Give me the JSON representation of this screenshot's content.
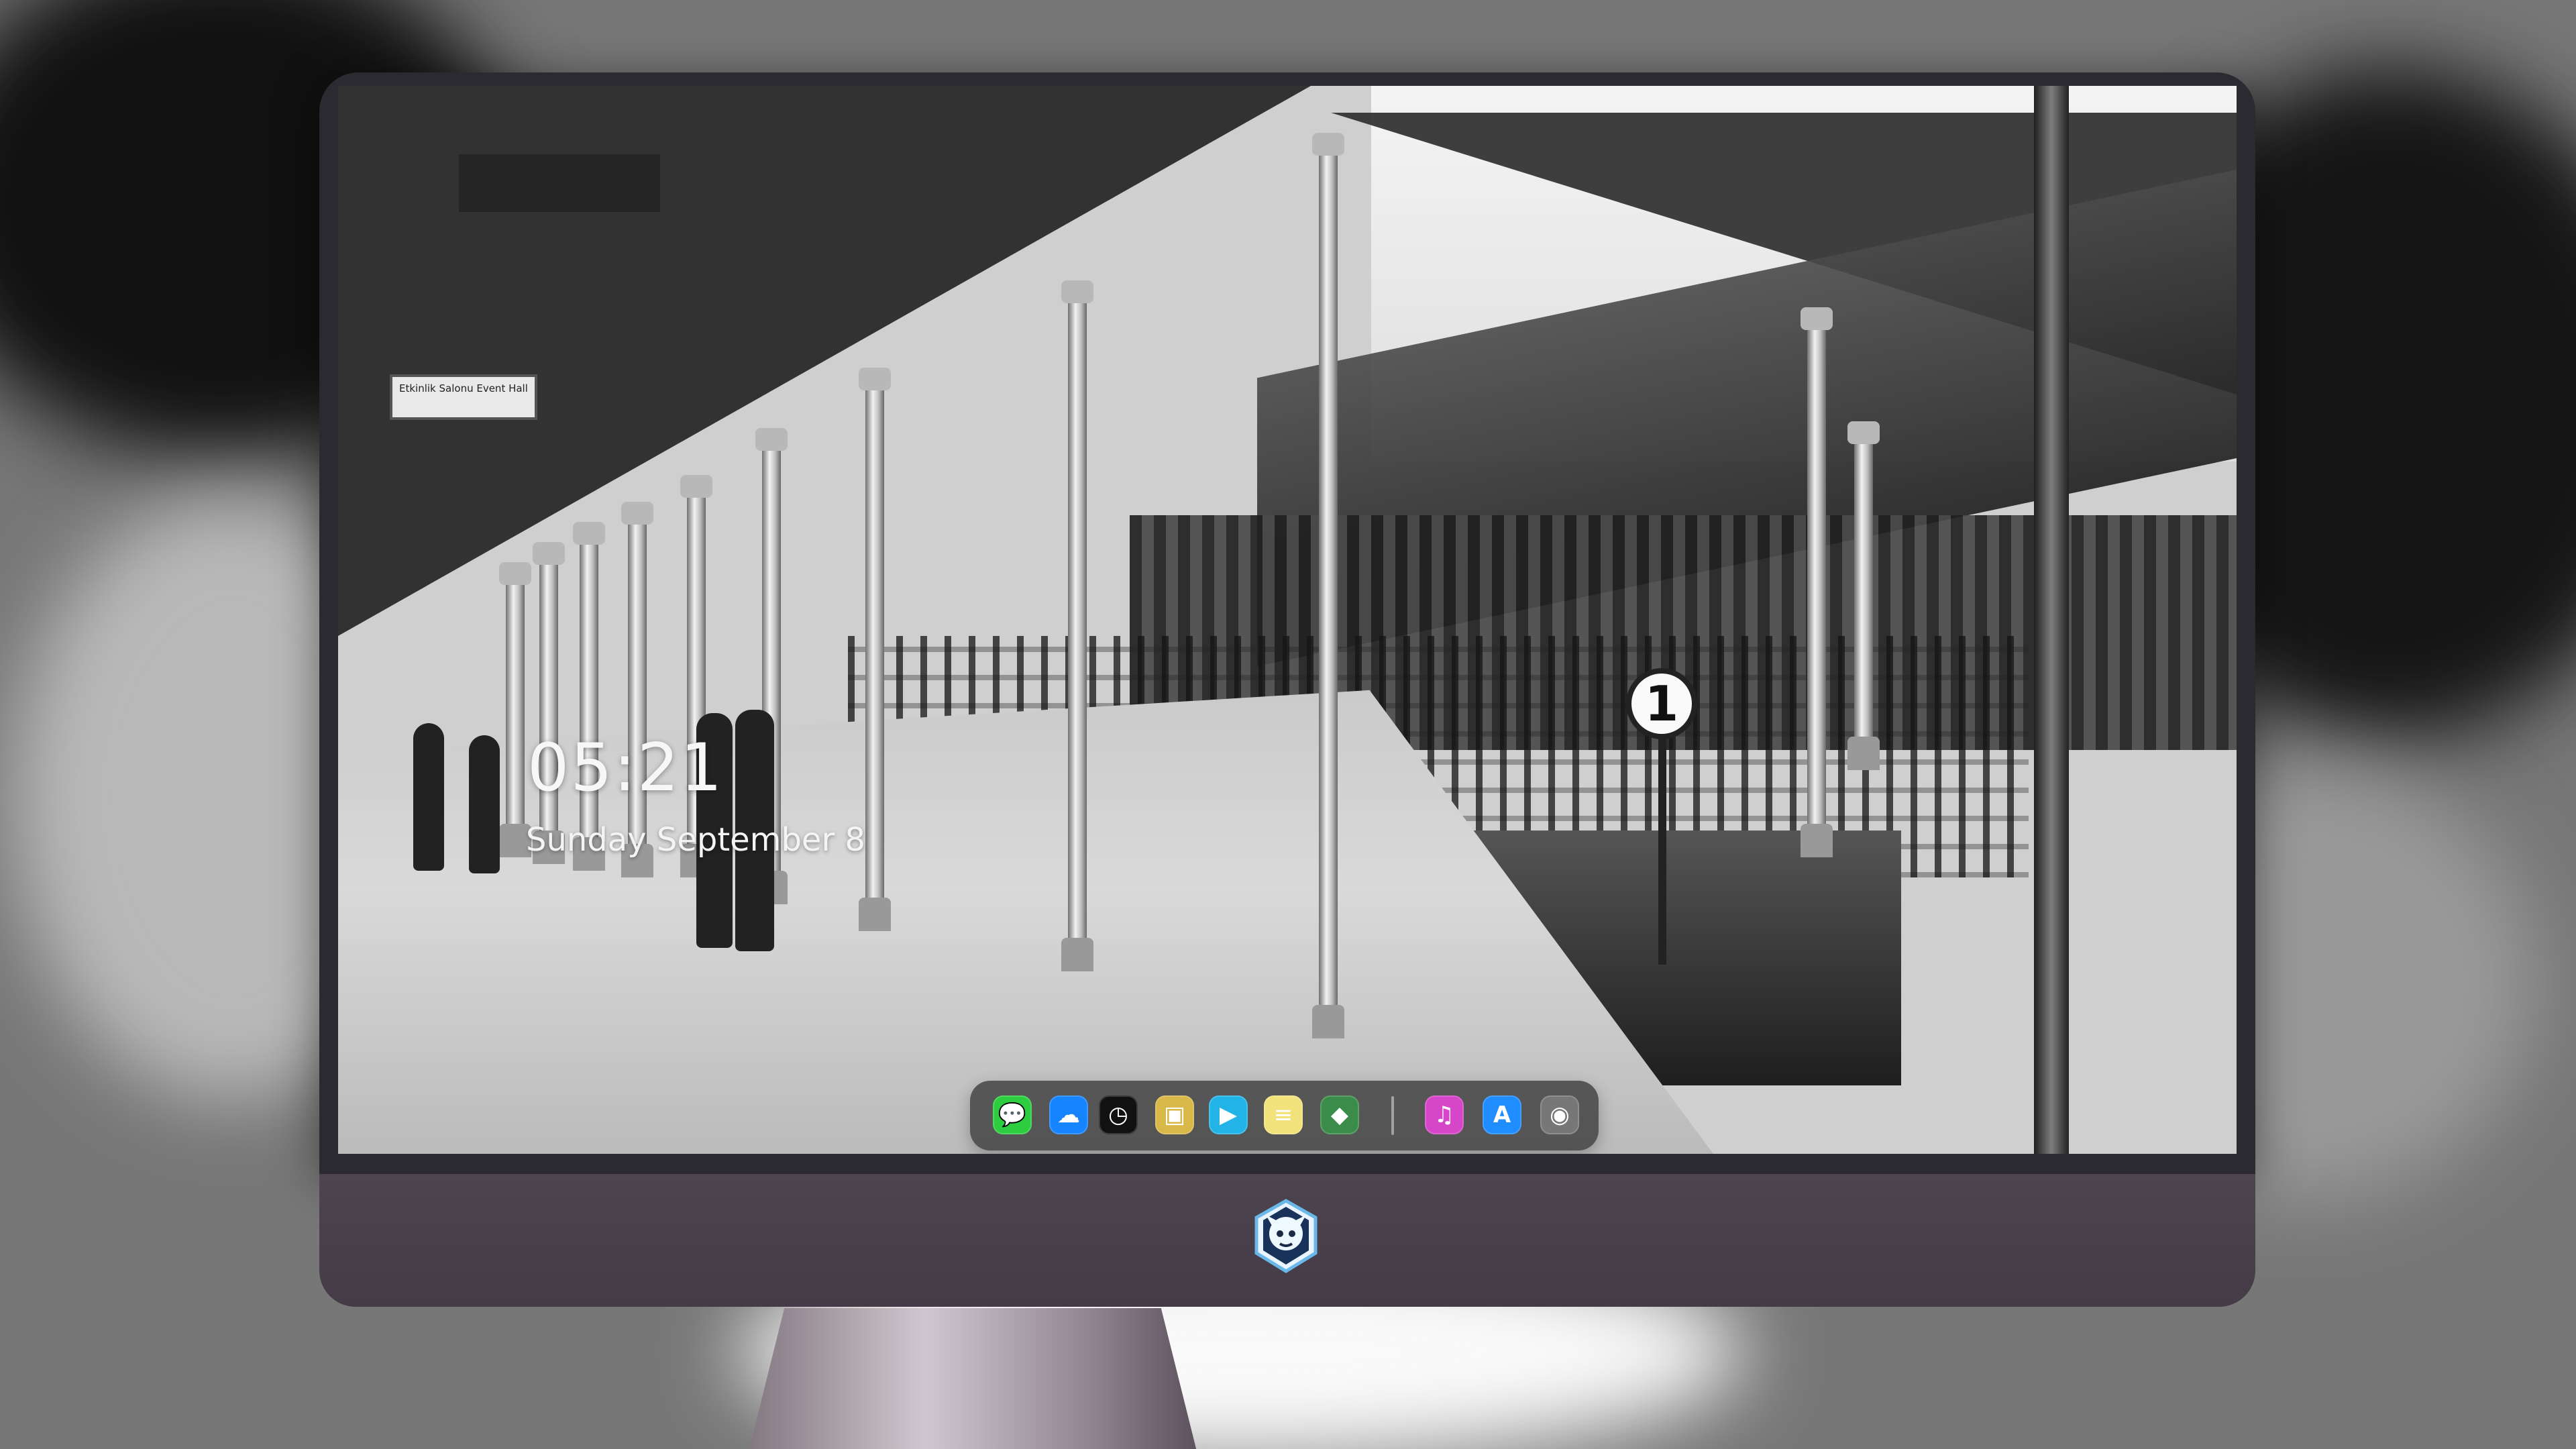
{
  "lock_screen": {
    "time": "05:21",
    "date": "Sunday September 8"
  },
  "station": {
    "sign": "Etkinlik Salonu\nEvent Hall",
    "platform_number": "1"
  },
  "dock": {
    "apps": [
      {
        "name": "Messages",
        "icon": "messages-icon",
        "glyph": "💬",
        "color": "#2ecc40"
      },
      {
        "name": "Weather",
        "icon": "weather-icon",
        "glyph": "☁",
        "color": "#1784ff"
      },
      {
        "name": "Clock",
        "icon": "clock-icon",
        "glyph": "◷",
        "color": "#111111"
      },
      {
        "name": "Preview",
        "icon": "preview-icon",
        "glyph": "▣",
        "color": "#d9b84a"
      },
      {
        "name": "Clips",
        "icon": "clips-icon",
        "glyph": "▶",
        "color": "#22b4e6"
      },
      {
        "name": "Notes",
        "icon": "notes-icon",
        "glyph": "≡",
        "color": "#f2e27c"
      },
      {
        "name": "Photo Booth",
        "icon": "photo-booth-icon",
        "glyph": "◆",
        "color": "#3b8c4a"
      },
      {
        "name": "Music",
        "icon": "music-icon",
        "glyph": "♫",
        "color": "#d546c8"
      },
      {
        "name": "App Store",
        "icon": "app-store-icon",
        "glyph": "A",
        "color": "#1f8cff"
      },
      {
        "name": "Camera",
        "icon": "camera-icon",
        "glyph": "◉",
        "color": "#777777"
      }
    ]
  }
}
